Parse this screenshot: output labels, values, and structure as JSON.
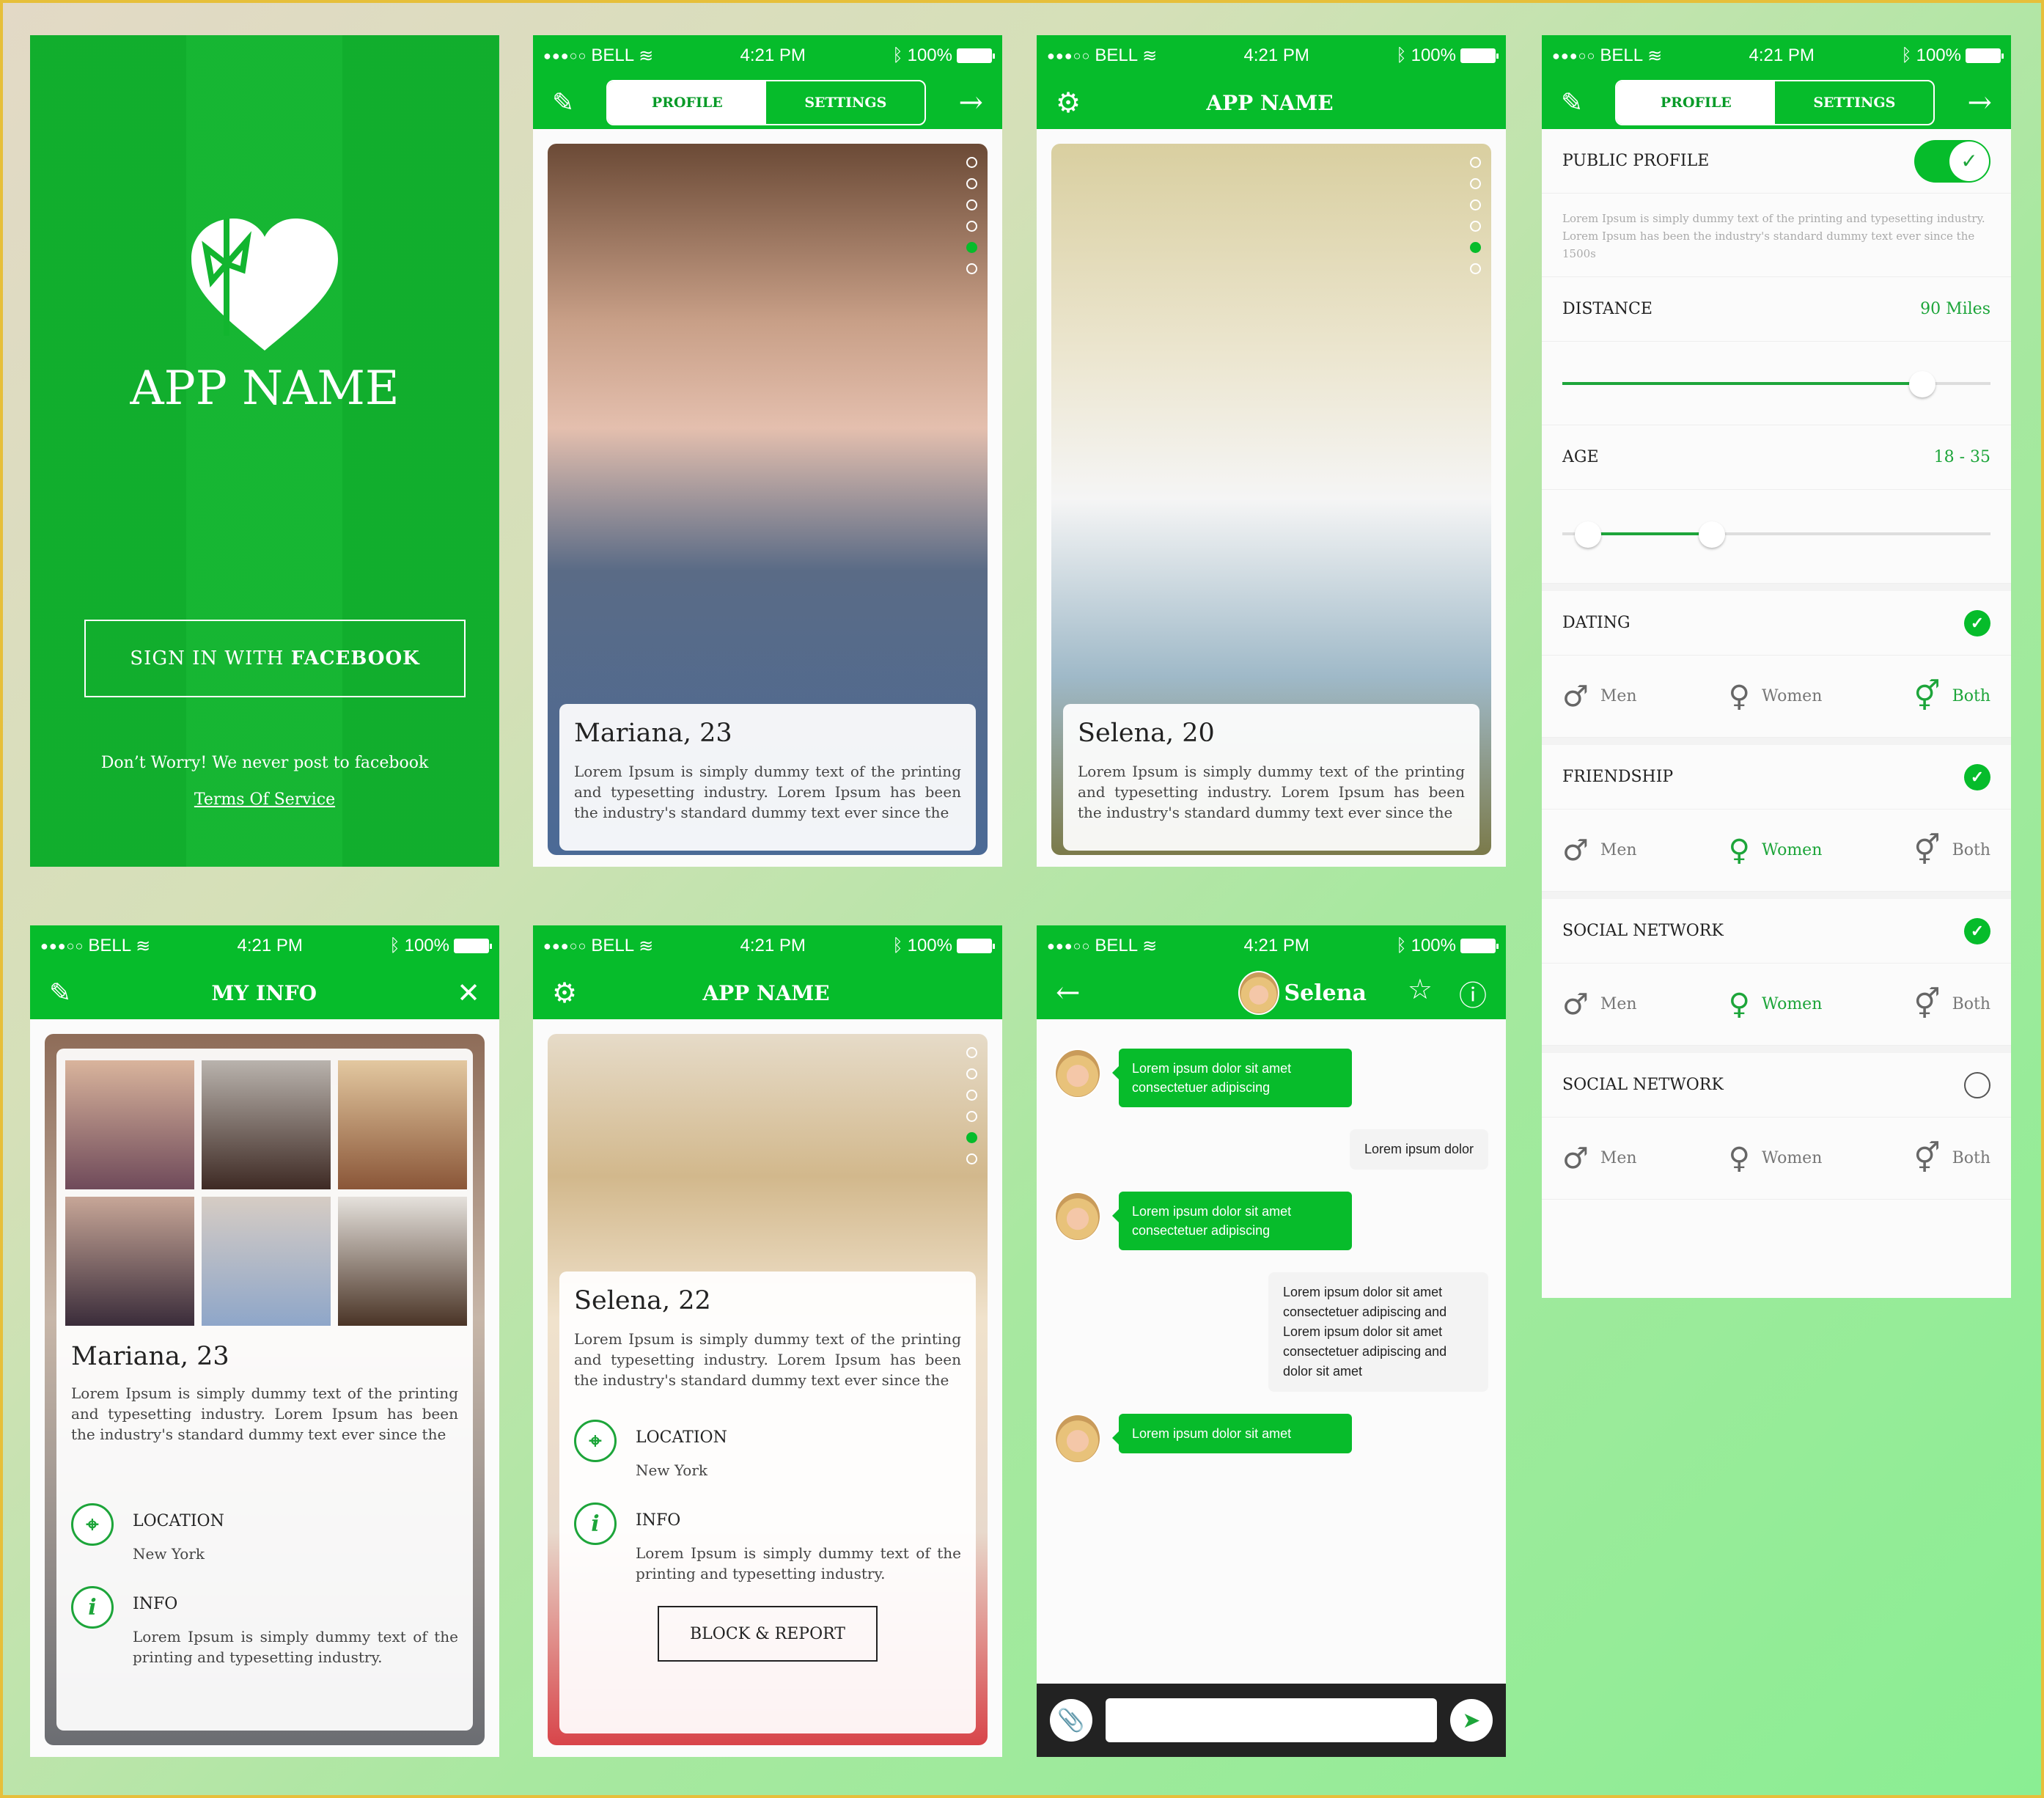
{
  "status": {
    "carrier": "BELL",
    "signal": "●●●○○",
    "time": "4:21 PM",
    "battery": "100%"
  },
  "splash": {
    "app_name": "APP NAME",
    "signin_prefix": "SIGN IN WITH ",
    "signin_bold": "FACEBOOK",
    "note": "Don’t Worry! We never post to facebook",
    "terms": "Terms Of Service"
  },
  "profile1": {
    "tabs": [
      "PROFILE",
      "SETTINGS"
    ],
    "name": "Mariana, 23",
    "bio": "Lorem Ipsum is simply dummy text of the printing and typesetting industry. Lorem Ipsum has been the industry's standard dummy text ever since the",
    "pager_count": 6,
    "pager_active": 4
  },
  "profile2": {
    "title": "APP NAME",
    "name": "Selena, 20",
    "bio": "Lorem Ipsum is simply dummy text of the printing and typesetting industry. Lorem Ipsum has been the industry's standard dummy text ever since the",
    "pager_count": 6,
    "pager_active": 4
  },
  "settings": {
    "tabs": [
      "PROFILE",
      "SETTINGS"
    ],
    "public_profile": {
      "label": "PUBLIC PROFILE",
      "enabled": true,
      "desc": "Lorem Ipsum is simply dummy text of the printing and typesetting industry. Lorem Ipsum has been the industry's standard dummy text ever since the 1500s"
    },
    "distance": {
      "label": "DISTANCE",
      "value": "90 Miles",
      "fraction": 0.84
    },
    "age": {
      "label": "AGE",
      "value": "18 - 35",
      "low_fraction": 0.06,
      "high_fraction": 0.35
    },
    "gender_labels": [
      "Men",
      "Women",
      "Both"
    ],
    "sections": [
      {
        "label": "DATING",
        "checked": true,
        "selected": 2
      },
      {
        "label": "FRIENDSHIP",
        "checked": true,
        "selected": 1
      },
      {
        "label": "SOCIAL NETWORK",
        "checked": true,
        "selected": 1
      },
      {
        "label": "SOCIAL NETWORK",
        "checked": false,
        "selected": -1
      }
    ]
  },
  "myinfo": {
    "title": "MY INFO",
    "name": "Mariana, 23",
    "bio": "Lorem Ipsum is simply dummy text of the printing and typesetting industry. Lorem Ipsum has been the industry's standard dummy text ever since the",
    "location_label": "LOCATION",
    "location": "New York",
    "info_label": "INFO",
    "info": "Lorem Ipsum is simply dummy text of the printing and typesetting industry."
  },
  "profile3": {
    "title": "APP NAME",
    "name": "Selena, 22",
    "bio": "Lorem Ipsum is simply dummy text of the printing and typesetting industry. Lorem Ipsum has been the industry's standard dummy text ever since the",
    "location_label": "LOCATION",
    "location": "New York",
    "info_label": "INFO",
    "info": "Lorem Ipsum is simply dummy text of the printing and typesetting industry.",
    "block_button": "BLOCK & REPORT",
    "pager_count": 6,
    "pager_active": 4
  },
  "chat": {
    "contact": "Selena",
    "messages": [
      {
        "from": "them",
        "text": "Lorem ipsum dolor sit amet consectetuer adipiscing"
      },
      {
        "from": "me",
        "text": "Lorem ipsum dolor"
      },
      {
        "from": "them",
        "text": "Lorem ipsum dolor sit amet consectetuer adipiscing"
      },
      {
        "from": "me",
        "text": "Lorem ipsum dolor sit amet consectetuer adipiscing and Lorem ipsum dolor sit amet consectetuer adipiscing and dolor sit amet"
      },
      {
        "from": "them",
        "text": "Lorem ipsum dolor sit amet"
      }
    ],
    "input_value": ""
  },
  "colors": {
    "brand": "#06bc2b",
    "accent_text": "#1da53a",
    "chat_bar": "#222222"
  }
}
